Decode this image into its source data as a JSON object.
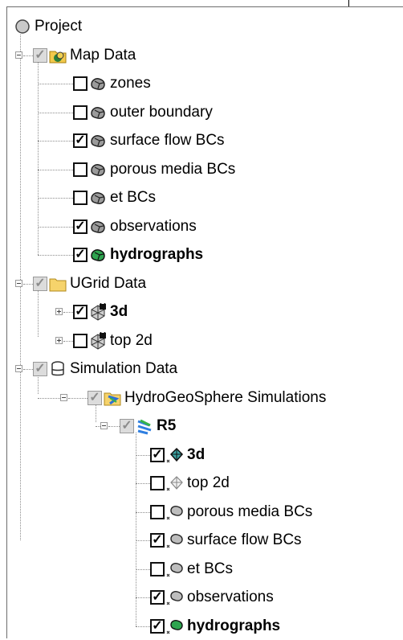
{
  "tree": {
    "root": {
      "label": "Project",
      "icon": "project-circle-icon"
    },
    "map_data": {
      "label": "Map Data",
      "icon": "map-data-folder-icon",
      "state": "indeterminate",
      "items": [
        {
          "label": "zones",
          "checked": false,
          "bold": false,
          "icon": "coverage-icon"
        },
        {
          "label": "outer boundary",
          "checked": false,
          "bold": false,
          "icon": "coverage-icon"
        },
        {
          "label": "surface flow BCs",
          "checked": true,
          "bold": false,
          "icon": "coverage-icon"
        },
        {
          "label": "porous media BCs",
          "checked": false,
          "bold": false,
          "icon": "coverage-icon"
        },
        {
          "label": "et BCs",
          "checked": false,
          "bold": false,
          "icon": "coverage-icon"
        },
        {
          "label": "observations",
          "checked": true,
          "bold": false,
          "icon": "coverage-icon"
        },
        {
          "label": "hydrographs",
          "checked": true,
          "bold": true,
          "icon": "active-coverage-icon"
        }
      ]
    },
    "ugrid_data": {
      "label": "UGrid Data",
      "icon": "folder-icon",
      "state": "indeterminate",
      "items": [
        {
          "label": "3d",
          "checked": true,
          "bold": true,
          "icon": "locked-ugrid-icon"
        },
        {
          "label": "top 2d",
          "checked": false,
          "bold": false,
          "icon": "locked-ugrid-icon"
        }
      ]
    },
    "simulation_data": {
      "label": "Simulation Data",
      "icon": "database-icon",
      "state": "indeterminate",
      "simulations": {
        "label": "HydroGeoSphere Simulations",
        "icon": "simulations-folder-icon",
        "state": "indeterminate",
        "sim": {
          "label": "R5",
          "icon": "simulation-icon",
          "bold": true,
          "state": "indeterminate",
          "items": [
            {
              "label": "3d",
              "checked": true,
              "bold": true,
              "icon": "linked-ugrid-icon"
            },
            {
              "label": "top 2d",
              "checked": false,
              "bold": false,
              "icon": "linked-ugrid-faded-icon"
            },
            {
              "label": "porous media BCs",
              "checked": false,
              "bold": false,
              "icon": "linked-coverage-icon"
            },
            {
              "label": "surface flow BCs",
              "checked": true,
              "bold": false,
              "icon": "linked-coverage-icon"
            },
            {
              "label": "et BCs",
              "checked": false,
              "bold": false,
              "icon": "linked-coverage-icon"
            },
            {
              "label": "observations",
              "checked": true,
              "bold": false,
              "icon": "linked-coverage-icon"
            },
            {
              "label": "hydrographs",
              "checked": true,
              "bold": true,
              "icon": "linked-active-coverage-icon"
            }
          ]
        }
      }
    }
  },
  "colors": {
    "coverage": "#9b9b9b",
    "active_coverage": "#2ea44f",
    "folder": "#f3c94b",
    "ugrid": "#3aa3a3"
  }
}
